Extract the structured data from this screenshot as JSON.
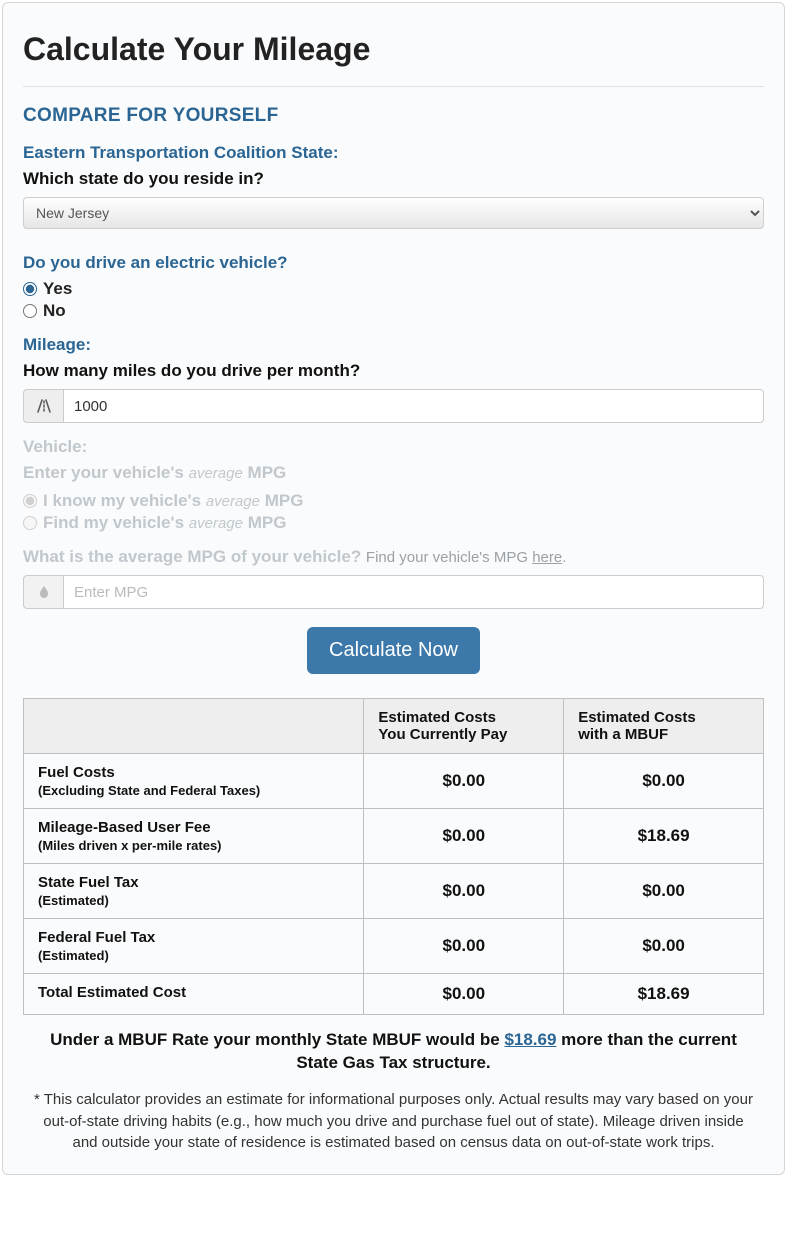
{
  "title": "Calculate Your Mileage",
  "compareHeading": "COMPARE FOR YOURSELF",
  "stateSection": {
    "label": "Eastern Transportation Coalition State:",
    "question": "Which state do you reside in?",
    "selected": "New Jersey"
  },
  "evSection": {
    "label": "Do you drive an electric vehicle?",
    "options": {
      "yes": "Yes",
      "no": "No"
    },
    "selected": "yes"
  },
  "mileageSection": {
    "label": "Mileage:",
    "question": "How many miles do you drive per month?",
    "value": "1000"
  },
  "vehicleSection": {
    "label": "Vehicle:",
    "prompt_pre": "Enter your vehicle's ",
    "prompt_ital": "average",
    "prompt_post": " MPG",
    "opt_know_pre": "I know my vehicle's ",
    "opt_know_ital": "average",
    "opt_know_post": " MPG",
    "opt_find_pre": "Find my vehicle's ",
    "opt_find_ital": "average",
    "opt_find_post": " MPG",
    "mpg_question": "What is the average MPG of your vehicle? ",
    "mpg_hint_pre": "Find your vehicle's MPG ",
    "mpg_hint_link": "here",
    "mpg_placeholder": "Enter MPG"
  },
  "calculateLabel": "Calculate Now",
  "tableHeaders": {
    "blank": "",
    "current_l1": "Estimated Costs",
    "current_l2": "You Currently Pay",
    "mbuf_l1": "Estimated Costs",
    "mbuf_l2": "with a MBUF"
  },
  "rows": {
    "fuel": {
      "label": "Fuel Costs",
      "sub": "(Excluding State and Federal Taxes)",
      "current": "$0.00",
      "mbuf": "$0.00"
    },
    "mbufFee": {
      "label": "Mileage-Based User Fee",
      "sub": "(Miles driven x per-mile rates)",
      "current": "$0.00",
      "mbuf": "$18.69"
    },
    "stateTax": {
      "label": "State Fuel Tax",
      "sub": "(Estimated)",
      "current": "$0.00",
      "mbuf": "$0.00"
    },
    "fedTax": {
      "label": "Federal Fuel Tax",
      "sub": "(Estimated)",
      "current": "$0.00",
      "mbuf": "$0.00"
    },
    "total": {
      "label": "Total Estimated Cost",
      "current": "$0.00",
      "mbuf": "$18.69"
    }
  },
  "summary": {
    "pre": "Under a MBUF Rate your monthly State MBUF would be ",
    "amount": "$18.69",
    "post": " more than the current State Gas Tax structure."
  },
  "disclaimer": "* This calculator provides an estimate for informational purposes only. Actual results may vary based on your out-of-state driving habits (e.g., how much you drive and purchase fuel out of state). Mileage driven inside and outside your state of residence is estimated based on census data on out-of-state work trips."
}
